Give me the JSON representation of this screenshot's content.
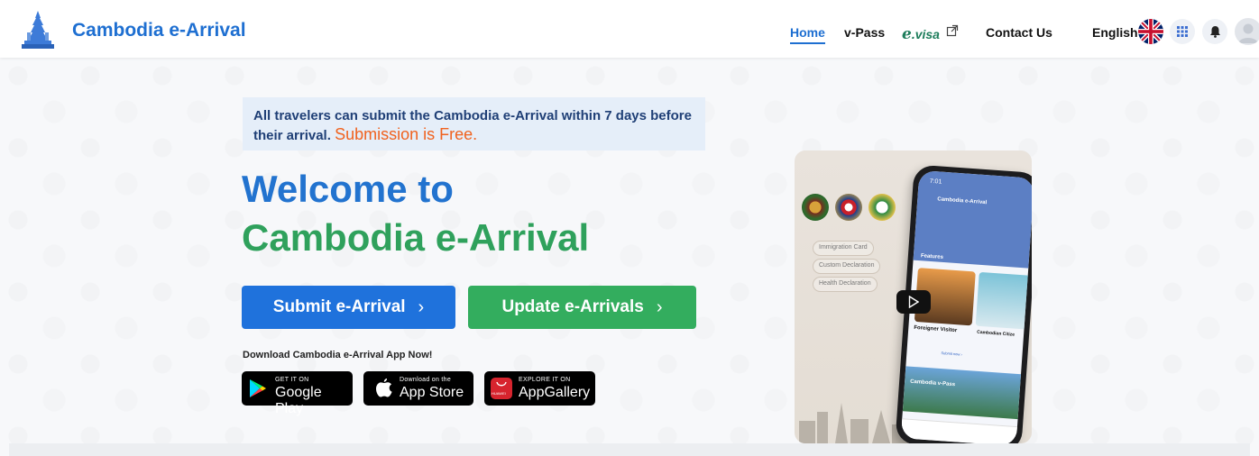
{
  "header": {
    "brand": "Cambodia e-Arrival",
    "nav": {
      "home": "Home",
      "vpass": "v-Pass",
      "evisa_e": "e",
      "evisa_rest": ".visa",
      "contact": "Contact Us"
    },
    "language": "English"
  },
  "notice": {
    "text": "All travelers can submit the Cambodia e-Arrival within 7 days before their arrival.",
    "free_text": "Submission is Free."
  },
  "hero": {
    "line1": "Welcome to",
    "line2": "Cambodia e-Arrival"
  },
  "buttons": {
    "submit": "Submit e-Arrival",
    "update": "Update e-Arrivals",
    "chevron": "›"
  },
  "download": {
    "label": "Download Cambodia e-Arrival App Now!",
    "google_small": "GET IT ON",
    "google_big": "Google Play",
    "apple_small": "Download on the",
    "apple_big": "App Store",
    "huawei_small": "EXPLORE IT ON",
    "huawei_big": "AppGallery",
    "huawei_badge": "HUAWEI"
  },
  "showcase": {
    "pills": [
      "Immigration Card",
      "Custom Declaration",
      "Health Declaration"
    ],
    "phone": {
      "time": "7:01",
      "app_name": "Cambodia e-Arrival",
      "features": "Features",
      "card1_title": "Foreigner Visitor",
      "card1_cta": "Submit now ›",
      "card2_title": "Cambodian Citize",
      "banner": "Cambodia v-Pass"
    }
  },
  "colors": {
    "brand_blue": "#1e6fd1",
    "green": "#33ad5e",
    "orange": "#f0621f"
  }
}
